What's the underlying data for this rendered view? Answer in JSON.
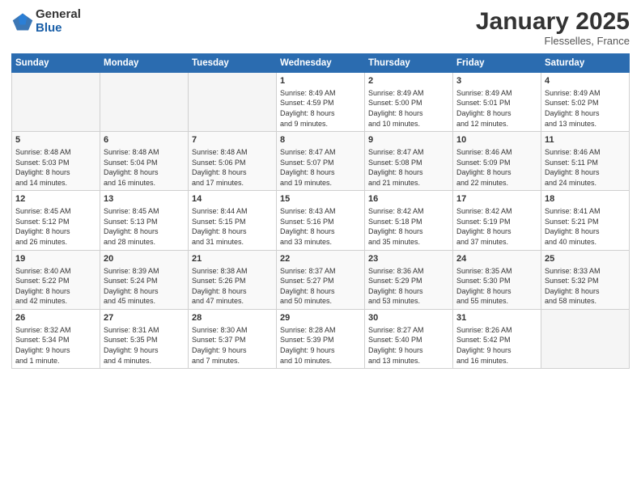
{
  "header": {
    "logo_general": "General",
    "logo_blue": "Blue",
    "month_title": "January 2025",
    "location": "Flesselles, France"
  },
  "calendar": {
    "weekdays": [
      "Sunday",
      "Monday",
      "Tuesday",
      "Wednesday",
      "Thursday",
      "Friday",
      "Saturday"
    ],
    "weeks": [
      [
        {
          "day": "",
          "info": ""
        },
        {
          "day": "",
          "info": ""
        },
        {
          "day": "",
          "info": ""
        },
        {
          "day": "1",
          "info": "Sunrise: 8:49 AM\nSunset: 4:59 PM\nDaylight: 8 hours\nand 9 minutes."
        },
        {
          "day": "2",
          "info": "Sunrise: 8:49 AM\nSunset: 5:00 PM\nDaylight: 8 hours\nand 10 minutes."
        },
        {
          "day": "3",
          "info": "Sunrise: 8:49 AM\nSunset: 5:01 PM\nDaylight: 8 hours\nand 12 minutes."
        },
        {
          "day": "4",
          "info": "Sunrise: 8:49 AM\nSunset: 5:02 PM\nDaylight: 8 hours\nand 13 minutes."
        }
      ],
      [
        {
          "day": "5",
          "info": "Sunrise: 8:48 AM\nSunset: 5:03 PM\nDaylight: 8 hours\nand 14 minutes."
        },
        {
          "day": "6",
          "info": "Sunrise: 8:48 AM\nSunset: 5:04 PM\nDaylight: 8 hours\nand 16 minutes."
        },
        {
          "day": "7",
          "info": "Sunrise: 8:48 AM\nSunset: 5:06 PM\nDaylight: 8 hours\nand 17 minutes."
        },
        {
          "day": "8",
          "info": "Sunrise: 8:47 AM\nSunset: 5:07 PM\nDaylight: 8 hours\nand 19 minutes."
        },
        {
          "day": "9",
          "info": "Sunrise: 8:47 AM\nSunset: 5:08 PM\nDaylight: 8 hours\nand 21 minutes."
        },
        {
          "day": "10",
          "info": "Sunrise: 8:46 AM\nSunset: 5:09 PM\nDaylight: 8 hours\nand 22 minutes."
        },
        {
          "day": "11",
          "info": "Sunrise: 8:46 AM\nSunset: 5:11 PM\nDaylight: 8 hours\nand 24 minutes."
        }
      ],
      [
        {
          "day": "12",
          "info": "Sunrise: 8:45 AM\nSunset: 5:12 PM\nDaylight: 8 hours\nand 26 minutes."
        },
        {
          "day": "13",
          "info": "Sunrise: 8:45 AM\nSunset: 5:13 PM\nDaylight: 8 hours\nand 28 minutes."
        },
        {
          "day": "14",
          "info": "Sunrise: 8:44 AM\nSunset: 5:15 PM\nDaylight: 8 hours\nand 31 minutes."
        },
        {
          "day": "15",
          "info": "Sunrise: 8:43 AM\nSunset: 5:16 PM\nDaylight: 8 hours\nand 33 minutes."
        },
        {
          "day": "16",
          "info": "Sunrise: 8:42 AM\nSunset: 5:18 PM\nDaylight: 8 hours\nand 35 minutes."
        },
        {
          "day": "17",
          "info": "Sunrise: 8:42 AM\nSunset: 5:19 PM\nDaylight: 8 hours\nand 37 minutes."
        },
        {
          "day": "18",
          "info": "Sunrise: 8:41 AM\nSunset: 5:21 PM\nDaylight: 8 hours\nand 40 minutes."
        }
      ],
      [
        {
          "day": "19",
          "info": "Sunrise: 8:40 AM\nSunset: 5:22 PM\nDaylight: 8 hours\nand 42 minutes."
        },
        {
          "day": "20",
          "info": "Sunrise: 8:39 AM\nSunset: 5:24 PM\nDaylight: 8 hours\nand 45 minutes."
        },
        {
          "day": "21",
          "info": "Sunrise: 8:38 AM\nSunset: 5:26 PM\nDaylight: 8 hours\nand 47 minutes."
        },
        {
          "day": "22",
          "info": "Sunrise: 8:37 AM\nSunset: 5:27 PM\nDaylight: 8 hours\nand 50 minutes."
        },
        {
          "day": "23",
          "info": "Sunrise: 8:36 AM\nSunset: 5:29 PM\nDaylight: 8 hours\nand 53 minutes."
        },
        {
          "day": "24",
          "info": "Sunrise: 8:35 AM\nSunset: 5:30 PM\nDaylight: 8 hours\nand 55 minutes."
        },
        {
          "day": "25",
          "info": "Sunrise: 8:33 AM\nSunset: 5:32 PM\nDaylight: 8 hours\nand 58 minutes."
        }
      ],
      [
        {
          "day": "26",
          "info": "Sunrise: 8:32 AM\nSunset: 5:34 PM\nDaylight: 9 hours\nand 1 minute."
        },
        {
          "day": "27",
          "info": "Sunrise: 8:31 AM\nSunset: 5:35 PM\nDaylight: 9 hours\nand 4 minutes."
        },
        {
          "day": "28",
          "info": "Sunrise: 8:30 AM\nSunset: 5:37 PM\nDaylight: 9 hours\nand 7 minutes."
        },
        {
          "day": "29",
          "info": "Sunrise: 8:28 AM\nSunset: 5:39 PM\nDaylight: 9 hours\nand 10 minutes."
        },
        {
          "day": "30",
          "info": "Sunrise: 8:27 AM\nSunset: 5:40 PM\nDaylight: 9 hours\nand 13 minutes."
        },
        {
          "day": "31",
          "info": "Sunrise: 8:26 AM\nSunset: 5:42 PM\nDaylight: 9 hours\nand 16 minutes."
        },
        {
          "day": "",
          "info": ""
        }
      ]
    ]
  }
}
